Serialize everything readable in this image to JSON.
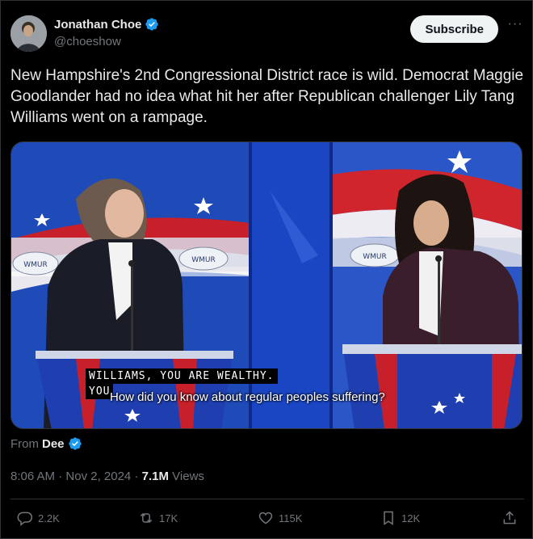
{
  "author": {
    "display_name": "Jonathan Choe",
    "handle": "@choeshow",
    "verified_icon": "verified-badge-icon",
    "accent": "#1d9bf0"
  },
  "header": {
    "subscribe_label": "Subscribe",
    "more_label": "···"
  },
  "tweet": {
    "text": "New Hampshire's 2nd Congressional District race is wild. Democrat Maggie Goodlander had no idea what hit her after Republican challenger Lily Tang Williams went on a rampage."
  },
  "media": {
    "caption_line1": "WILLIAMS, YOU ARE WEALTHY.",
    "caption_line2": "YOU",
    "subtitle": "How did you know about regular peoples suffering?",
    "logo_text_left": "WMUR",
    "logo_text_center": "WMUR",
    "logo_text_right": "WMUR"
  },
  "source": {
    "prefix": "From",
    "name": "Dee"
  },
  "meta": {
    "time": "8:06 AM",
    "date": "Nov 2, 2024",
    "views_count": "7.1M",
    "views_label": "Views"
  },
  "actions": {
    "replies": "2.2K",
    "reposts": "17K",
    "likes": "115K",
    "bookmarks": "12K"
  }
}
